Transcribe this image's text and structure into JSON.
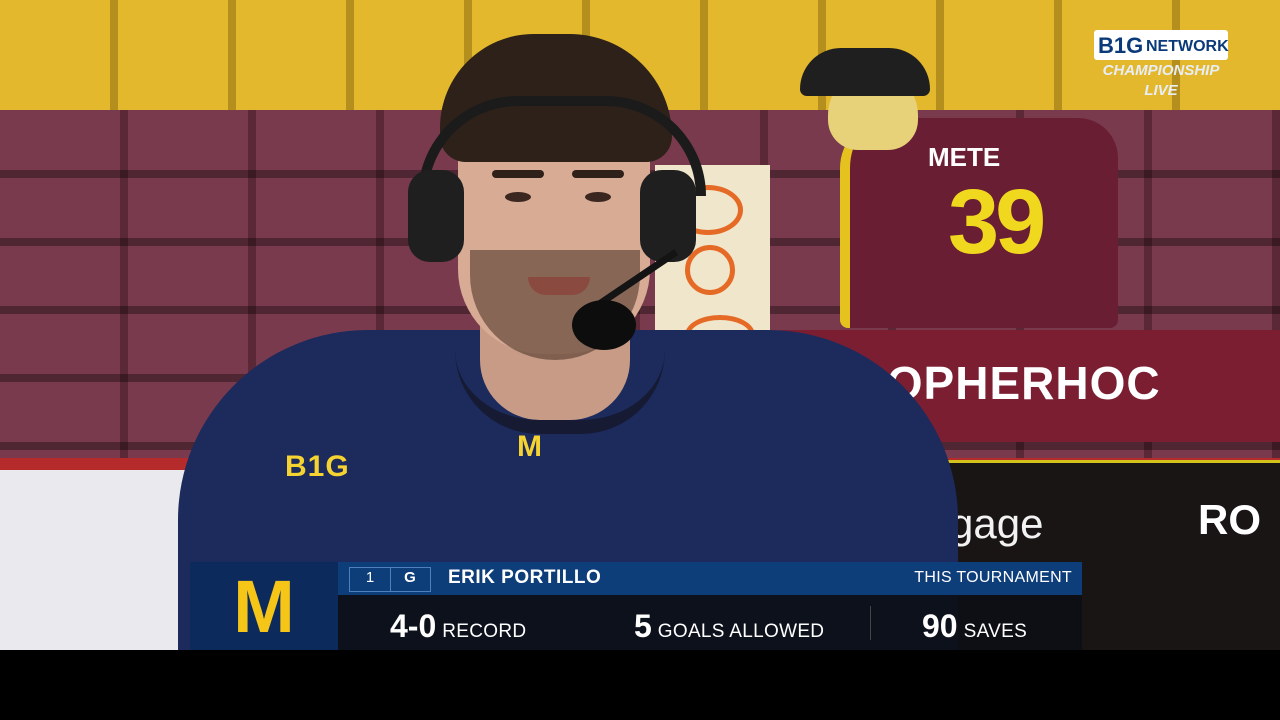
{
  "network_bug": {
    "logo_b1g": "B1G",
    "logo_network": "NETWORK",
    "line1": "CHAMPIONSHIP",
    "line2": "LIVE"
  },
  "scene": {
    "banner_text": "GOPHERHOC",
    "ad_text_1": "gage",
    "ad_text_2": "RO",
    "fan_jersey_name": "METE",
    "fan_jersey_number": "39",
    "player_chest_logo": "B1G",
    "player_collar_logo": "M"
  },
  "lower_third": {
    "team_logo": "M",
    "jersey_number": "1",
    "position": "G",
    "player_name": "ERIK PORTILLO",
    "context": "THIS TOURNAMENT",
    "stats": [
      {
        "value": "4-0",
        "label": "RECORD"
      },
      {
        "value": "5",
        "label": "GOALS ALLOWED"
      },
      {
        "value": "90",
        "label": "SAVES"
      }
    ],
    "colors": {
      "team_blue": "#0d2a5c",
      "maize": "#f5c518",
      "bar_blue": "#0e3e7a"
    }
  }
}
